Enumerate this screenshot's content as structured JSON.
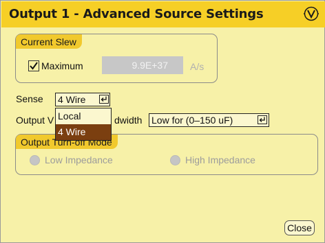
{
  "dialog": {
    "title": "Output 1 - Advanced Source Settings",
    "logo_icon": "agilent-v-logo-icon"
  },
  "current_slew": {
    "group_label": "Current Slew",
    "maximum_label": "Maximum",
    "maximum_checked": true,
    "value": "9.9E+37",
    "unit": "A/s"
  },
  "sense": {
    "label": "Sense",
    "selected": "4 Wire",
    "options": [
      "Local",
      "4 Wire"
    ],
    "highlighted_option": "4 Wire"
  },
  "output_bandwidth": {
    "label_left": "Output V",
    "label_right": "dwidth",
    "selected": "Low for (0–150 uF)"
  },
  "output_turn_off_mode": {
    "group_label": "Output Turn-off Mode",
    "low_impedance_label": "Low Impedance",
    "high_impedance_label": "High Impedance"
  },
  "footer": {
    "close_label": "Close"
  },
  "colors": {
    "background": "#f7f1a8",
    "title_bar": "#f6cf26",
    "group_label_bg": "#f1c92d",
    "highlight": "#7b3f10",
    "disabled": "#c7c7c7"
  }
}
